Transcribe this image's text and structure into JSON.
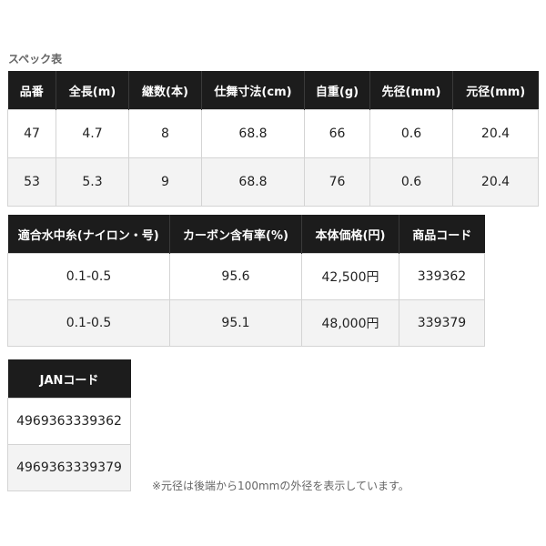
{
  "title": "スペック表",
  "table1": {
    "headers": [
      "品番",
      "全長(m)",
      "継数(本)",
      "仕舞寸法(cm)",
      "自重(g)",
      "先径(mm)",
      "元径(mm)"
    ],
    "rows": [
      [
        "47",
        "4.7",
        "8",
        "68.8",
        "66",
        "0.6",
        "20.4"
      ],
      [
        "53",
        "5.3",
        "9",
        "68.8",
        "76",
        "0.6",
        "20.4"
      ]
    ]
  },
  "table2": {
    "headers": [
      "適合水中糸(ナイロン・号)",
      "カーボン含有率(%)",
      "本体価格(円)",
      "商品コード"
    ],
    "rows": [
      [
        "0.1-0.5",
        "95.6",
        "42,500円",
        "339362"
      ],
      [
        "0.1-0.5",
        "95.1",
        "48,000円",
        "339379"
      ]
    ]
  },
  "table3": {
    "headers": [
      "JANコード"
    ],
    "rows": [
      [
        "4969363339362"
      ],
      [
        "4969363339379"
      ]
    ]
  },
  "note": "※元径は後端から100mmの外径を表示しています。"
}
